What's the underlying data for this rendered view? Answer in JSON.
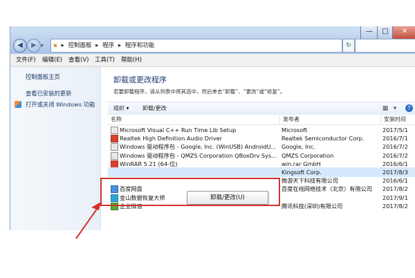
{
  "window": {
    "controls": [
      "—",
      "□",
      "✕"
    ]
  },
  "address": {
    "separator": "▸",
    "parts": [
      "控制面板",
      "程序",
      "程序和功能"
    ]
  },
  "menu": {
    "items": [
      "文件(F)",
      "编辑(E)",
      "查看(V)",
      "工具(T)",
      "帮助(H)"
    ]
  },
  "sidebar": {
    "links": [
      "控制面板主页",
      "查看已安装的更新",
      "打开或关闭 Windows 功能"
    ]
  },
  "main": {
    "heading": "卸载或更改程序",
    "description": "若要卸载程序，请从列表中将其选中，然后单击“卸载”、“更改”或“修复”。",
    "toolbar": {
      "organize": "组织 ▾",
      "uninstall_change": "卸载/更改",
      "help": "?"
    },
    "columns": [
      "名称",
      "发布者",
      "安装时间"
    ],
    "rows": [
      {
        "name": "Microsoft Visual C++ Run Time  Lib Setup",
        "publisher": "Microsoft",
        "date": "2017/5/1",
        "icon": "installer-icon",
        "color": "plain"
      },
      {
        "name": "Realtek High Definition Audio Driver",
        "publisher": "Realtek Semiconductor Corp.",
        "date": "2016/7/1",
        "icon": "speaker-icon",
        "color": "red"
      },
      {
        "name": "Windows 驱动程序包 - Google, Inc. (WinUSB) AndroidU...",
        "publisher": "Google, Inc.",
        "date": "2016/7/2",
        "icon": "driver-icon",
        "color": "plain"
      },
      {
        "name": "Windows 驱动程序包 - QMZS Corporation QBoxDrv Sys...",
        "publisher": "QMZS Corporation",
        "date": "2016/7/2",
        "icon": "driver-icon",
        "color": "plain"
      },
      {
        "name": "WinRAR 5.21 (64-位)",
        "publisher": "win.rar GmbH",
        "date": "2016/6/1",
        "icon": "winrar-icon",
        "color": "red"
      },
      {
        "name": "",
        "publisher": "Kingsoft Corp.",
        "date": "2017/8/3",
        "icon": "",
        "color": "none"
      },
      {
        "name": "",
        "publisher": "微游天下科技有限公司",
        "date": "2016/6/1",
        "icon": "",
        "color": "none"
      },
      {
        "name": "百度网盘",
        "publisher": "百度在线网络技术（北京）有限公司",
        "date": "2017/8/2",
        "icon": "baidu-netdisk-icon",
        "color": "blue"
      },
      {
        "name": "金山数据恢复大师",
        "publisher": "",
        "date": "2017/9/1",
        "icon": "recovery-icon",
        "color": "cyan"
      },
      {
        "name": "企业微信",
        "publisher": "腾讯科技(深圳)有限公司",
        "date": "2017/8/2",
        "icon": "wechat-work-icon",
        "color": "green"
      }
    ],
    "selected_index": 5
  },
  "context_menu": {
    "uninstall_label": "卸载/更改(U)"
  },
  "colors": {
    "highlight_box": "#d6302a",
    "heading": "#1e3b78",
    "link": "#1c3a6b"
  }
}
